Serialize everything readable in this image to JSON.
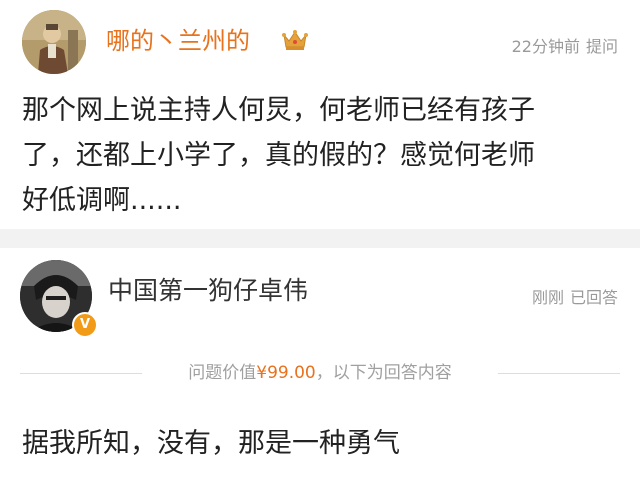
{
  "question": {
    "user_name": "哪的丶兰州的",
    "time": "22分钟前",
    "action": "提问",
    "text_lines": [
      "那个网上说主持人何炅，何老师已经有孩子",
      "了，还都上小学了，真的假的？感觉何老师",
      "好低调啊......"
    ]
  },
  "answer": {
    "user_name": "中国第一狗仔卓伟",
    "time": "刚刚",
    "status": "已回答",
    "verified_badge": "V",
    "price_prefix": "问题价值",
    "price_value": "¥99.00",
    "price_suffix": "，以下为回答内容",
    "text": "据我所知，没有，那是一种勇气"
  },
  "colors": {
    "accent": "#e8721d",
    "meta_gray": "#9a9a9a",
    "badge_orange": "#f29b18",
    "crown_gold": "#e5a23a"
  },
  "icons": {
    "crown": "crown-icon",
    "verified": "verified-badge-icon"
  }
}
